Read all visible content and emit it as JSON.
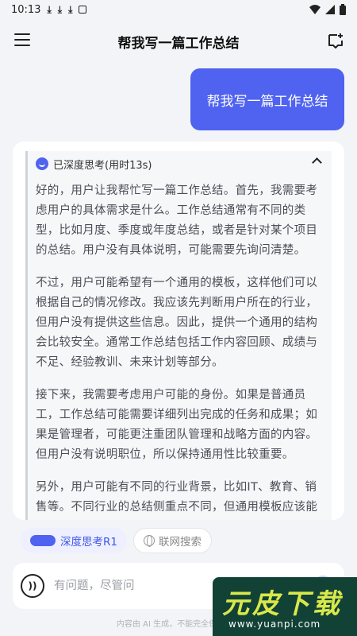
{
  "status_bar": {
    "time": "10:13",
    "notification_icons": [
      "download-icon",
      "download-icon",
      "download-icon",
      "a-badge-icon"
    ],
    "system_icons": [
      "wifi-icon",
      "signal-icon",
      "battery-icon"
    ]
  },
  "header": {
    "title": "帮我写一篇工作总结"
  },
  "user_message": {
    "text": "帮我写一篇工作总结"
  },
  "thinking": {
    "label": "已深度思考(用时13s)",
    "paragraphs": [
      "好的，用户让我帮忙写一篇工作总结。首先，我需要考虑用户的具体需求是什么。工作总结通常有不同的类型，比如月度、季度或年度总结，或者是针对某个项目的总结。用户没有具体说明，可能需要先询问清楚。",
      "不过，用户可能希望有一个通用的模板，这样他们可以根据自己的情况修改。我应该先判断用户所在的行业，但用户没有提供这些信息。因此，提供一个通用的结构会比较安全。通常工作总结包括工作内容回顾、成绩与不足、经验教训、未来计划等部分。",
      "接下来，我需要考虑用户可能的身份。如果是普通员工，工作总结可能需要详细列出完成的任务和成果；如果是管理者，可能更注重团队管理和战略方面的内容。但用户没有说明职位，所以保持通用性比较重要。",
      "另外，用户可能有不同的行业背景，比如IT、教育、销售等。不同行业的总结侧重点不同，但通用模板应该能覆"
    ]
  },
  "chips": {
    "deep_think": "深度思考R1",
    "web_search": "联网搜索"
  },
  "input": {
    "placeholder": "有问题，尽管问"
  },
  "disclaimer": "内容由 AI 生成，不能完全保障真实",
  "watermark": {
    "text": "元皮下载",
    "url": "www.yuanpi.com"
  },
  "colors": {
    "accent": "#4f63f0",
    "background": "#f3f4f7",
    "watermark_bg": "#124236",
    "watermark_text": "#d9e84a"
  }
}
